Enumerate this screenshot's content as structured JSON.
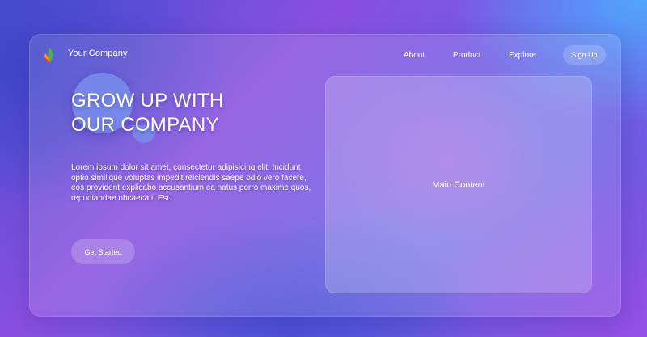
{
  "header": {
    "brand": "Your Company",
    "nav": [
      {
        "label": "About"
      },
      {
        "label": "Product"
      },
      {
        "label": "Explore"
      }
    ],
    "signup_label": "Sign Up"
  },
  "hero": {
    "title_line1": "GROW UP WITH",
    "title_line2": "OUR COMPANY",
    "body": "Lorem ipsum dolor sit amet, consectetur adipisicing elit. Incidunt optio similique voluptas impedit reiciendis saepe odio vero facere, eos provident explicabo accusantium ea natus porro maxime quos, repudiandae obcaecati. Est.",
    "cta_label": "Get Started"
  },
  "main_panel": {
    "label": "Main Content"
  },
  "icons": {
    "logo": "leaf-logo-icon"
  },
  "colors": {
    "text": "#ffffff",
    "logo_green": "#4caf50",
    "logo_red": "#e53935",
    "logo_orange": "#ff9800"
  }
}
